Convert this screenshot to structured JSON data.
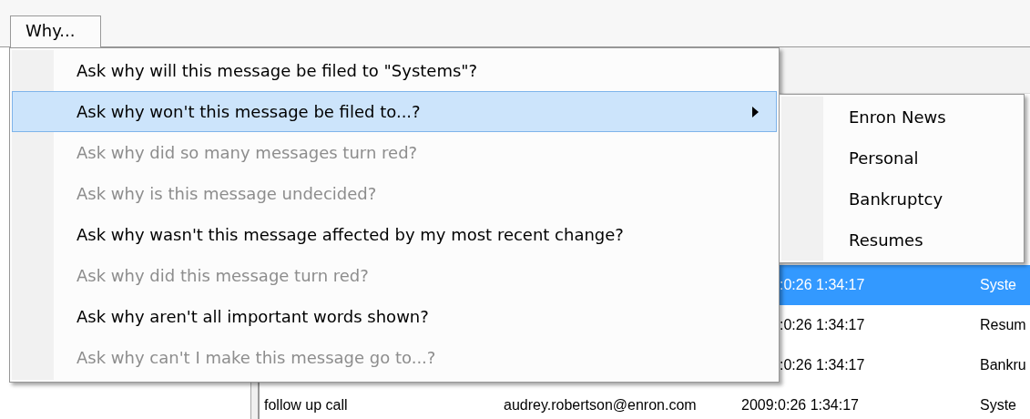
{
  "tabs": [
    {
      "label": "Why..."
    }
  ],
  "menu": {
    "items": [
      {
        "label": "Ask why will this message be filed to \"Systems\"?",
        "disabled": false,
        "selected": false
      },
      {
        "label": "Ask why won't this message be filed to...?",
        "disabled": false,
        "selected": true,
        "submenu": [
          "Enron News",
          "Personal",
          "Bankruptcy",
          "Resumes"
        ]
      },
      {
        "label": "Ask why did so many messages turn red?",
        "disabled": true,
        "selected": false
      },
      {
        "label": "Ask why is this message undecided?",
        "disabled": true,
        "selected": false
      },
      {
        "label": "Ask why wasn't this message affected by my most recent change?",
        "disabled": false,
        "selected": false
      },
      {
        "label": "Ask why did this message turn red?",
        "disabled": true,
        "selected": false
      },
      {
        "label": "Ask why aren't all important words shown?",
        "disabled": false,
        "selected": false
      },
      {
        "label": "Ask why can't I make this message go to...?",
        "disabled": true,
        "selected": false
      }
    ]
  },
  "table": {
    "rows": [
      {
        "date": ":0:26 1:34:17",
        "folder": "Syste",
        "selected": true
      },
      {
        "date": ":0:26 1:34:17",
        "folder": "Resum",
        "selected": false
      },
      {
        "date": ":0:26 1:34:17",
        "folder": "Bankru",
        "selected": false
      },
      {
        "subject": "follow up call",
        "sender": "audrey.robertson@enron.com",
        "date": "2009:0:26 1:34:17",
        "folder": "Syste",
        "selected": false
      }
    ]
  }
}
